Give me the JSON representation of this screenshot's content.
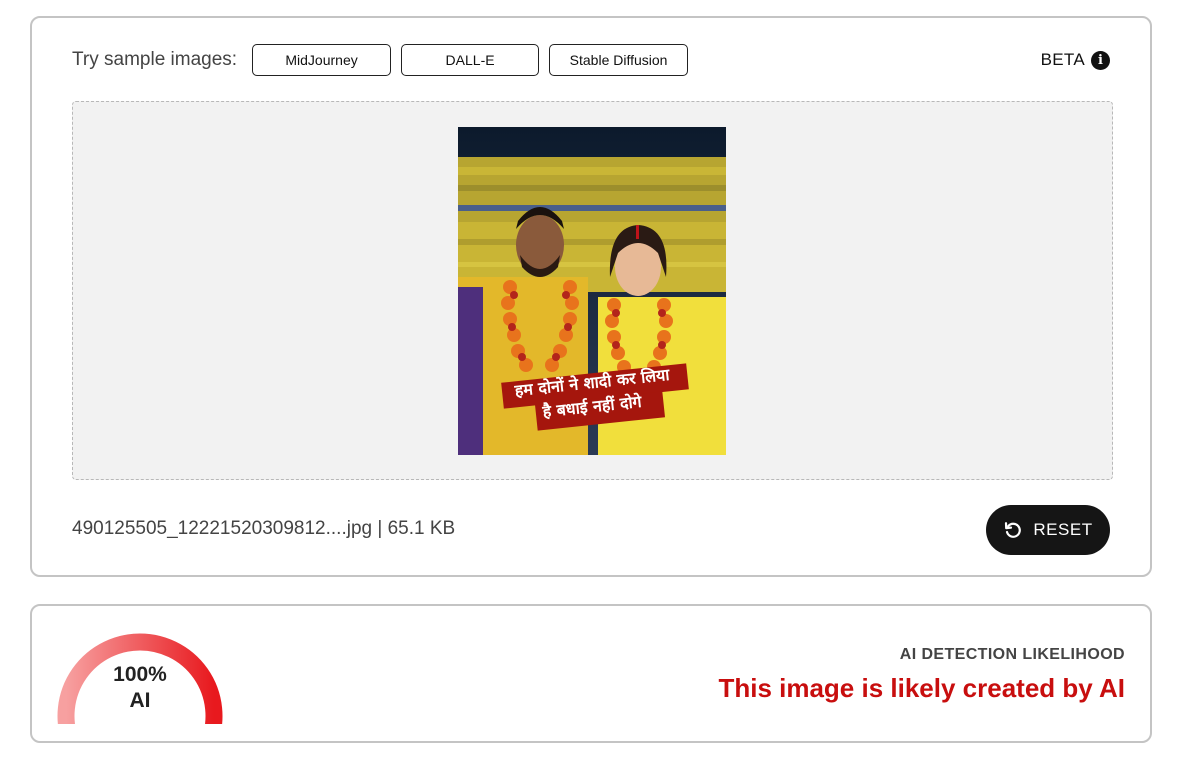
{
  "samples": {
    "label": "Try sample images:",
    "buttons": [
      "MidJourney",
      "DALL-E",
      "Stable Diffusion"
    ]
  },
  "beta": {
    "label": "BETA",
    "icon": "info-icon"
  },
  "preview": {
    "caption_line1": "हम दोनों ने शादी कर लिया",
    "caption_line2": "है बधाई नहीं दोगे"
  },
  "file": {
    "info": "490125505_12221520309812....jpg | 65.1 KB"
  },
  "reset": {
    "label": "RESET",
    "icon": "undo-icon"
  },
  "result": {
    "gauge_value": "100%",
    "gauge_unit": "AI",
    "gauge_fraction": 1.0,
    "likelihood_label": "AI DETECTION LIKELIHOOD",
    "verdict": "This image is likely created by AI"
  },
  "colors": {
    "verdict": "#c80e0e",
    "gauge_start": "#f7a0a0",
    "gauge_end": "#e8191e",
    "reset_bg": "#151515"
  }
}
